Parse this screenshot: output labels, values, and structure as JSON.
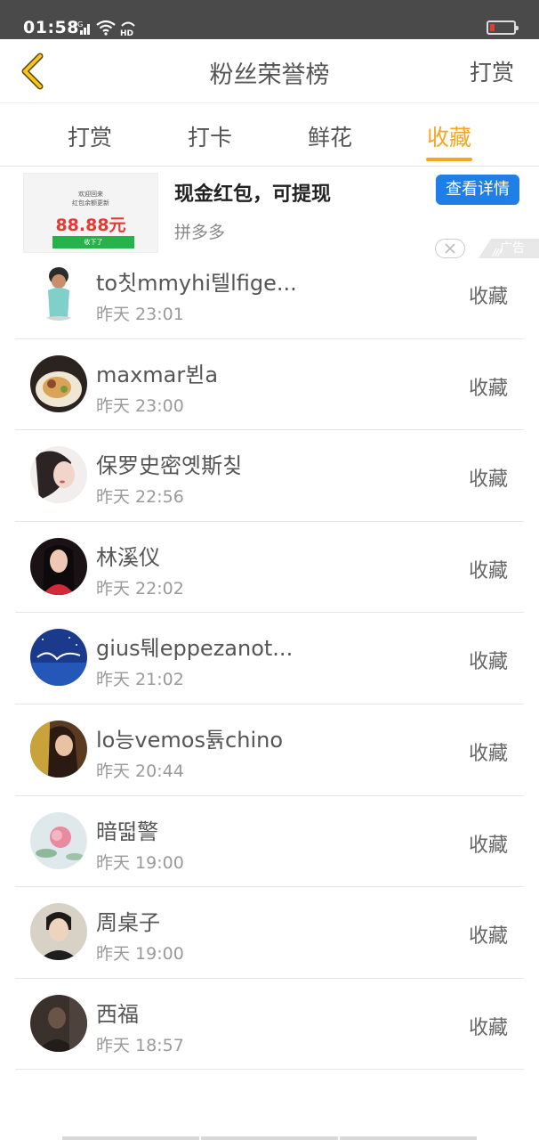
{
  "status_bar": {
    "time": "01:58",
    "network": "4G",
    "wifi_label": "HD",
    "battery_color": "#e53935"
  },
  "header": {
    "title": "粉丝荣誉榜",
    "right_label": "打赏",
    "back_icon": "chevron-left-icon",
    "accent": "#f5a623"
  },
  "tabs": [
    {
      "label": "打赏",
      "active": false
    },
    {
      "label": "打卡",
      "active": false
    },
    {
      "label": "鲜花",
      "active": false
    },
    {
      "label": "收藏",
      "active": true
    }
  ],
  "ad": {
    "thumb_line1": "欢迎回来",
    "thumb_line2": "红包余额更新",
    "thumb_amount": "88.88元",
    "thumb_button": "收下了",
    "title": "现金红包，可提现",
    "source": "拼多多",
    "cta": "查看详情",
    "label": "广告",
    "cta_color": "#1f7ee8"
  },
  "list": [
    {
      "name": "to칫mmyhi텔lfige...",
      "time": "昨天 23:01",
      "action": "收藏"
    },
    {
      "name": "maxmar뵌a",
      "time": "昨天 23:00",
      "action": "收藏"
    },
    {
      "name": "保罗史密옛斯칮",
      "time": "昨天 22:56",
      "action": "收藏"
    },
    {
      "name": "林溪仪",
      "time": "昨天 22:02",
      "action": "收藏"
    },
    {
      "name": "gius퉤eppezanot...",
      "time": "昨天 21:02",
      "action": "收藏"
    },
    {
      "name": "lo능vemos튥chino",
      "time": "昨天 20:44",
      "action": "收藏"
    },
    {
      "name": "暗떫警",
      "time": "昨天 19:00",
      "action": "收藏"
    },
    {
      "name": "周桌子",
      "time": "昨天 19:00",
      "action": "收藏"
    },
    {
      "name": "西福",
      "time": "昨天 18:57",
      "action": "收藏"
    }
  ]
}
